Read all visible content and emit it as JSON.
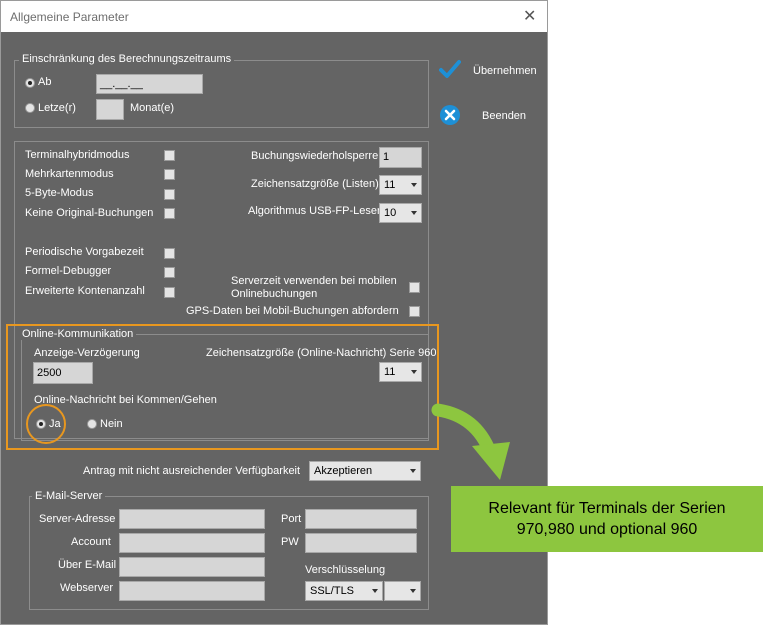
{
  "window": {
    "title": "Allgemeine Parameter",
    "close_symbol": "✕"
  },
  "actions": {
    "apply_label": "Übernehmen",
    "exit_label": "Beenden"
  },
  "period": {
    "legend": "Einschränkung des Berechnungszeitraums",
    "ab_label": "Ab",
    "ab_value": "__.__.__",
    "last_label": "Letze(r)",
    "last_value": "",
    "month_label": "Monat(e)"
  },
  "settings": {
    "checkboxes": {
      "terminalhybrid": "Terminalhybridmodus",
      "mehrkarten": "Mehrkartenmodus",
      "byte5": "5-Byte-Modus",
      "keine_original": "Keine Original-Buchungen",
      "periodische": "Periodische Vorgabezeit",
      "formel": "Formel-Debugger",
      "erweiterte": "Erweiterte Kontenanzahl",
      "serverzeit_line1": "Serverzeit verwenden bei mobilen",
      "serverzeit_line2": "Onlinebuchungen",
      "gps": "GPS-Daten bei Mobil-Buchungen abfordern"
    },
    "sperre_label": "Buchungswiederholsperre",
    "sperre_value": "1",
    "font_list_label": "Zeichensatzgröße (Listen)",
    "font_list_value": "11",
    "algo_label": "Algorithmus USB-FP-Leser",
    "algo_value": "10"
  },
  "online": {
    "legend": "Online-Kommunikation",
    "delay_label": "Anzeige-Verzögerung",
    "delay_value": "2500",
    "font_label": "Zeichensatzgröße (Online-Nachricht) Serie 960",
    "font_value": "11",
    "message_label": "Online-Nachricht bei Kommen/Gehen",
    "ja_label": "Ja",
    "nein_label": "Nein"
  },
  "antrag": {
    "label": "Antrag mit nicht ausreichender Verfügbarkeit",
    "value": "Akzeptieren"
  },
  "email": {
    "legend": "E-Mail-Server",
    "server_label": "Server-Adresse",
    "account_label": "Account",
    "via_label": "Über E-Mail",
    "webserver_label": "Webserver",
    "port_label": "Port",
    "pw_label": "PW",
    "encryption_label": "Verschlüsselung",
    "encryption_value": "SSL/TLS",
    "encryption_extra": ""
  },
  "callout": {
    "line1": "Relevant für Terminals der Serien",
    "line2": "970,980 und optional 960"
  },
  "colors": {
    "dialog_bg": "#646464",
    "highlight": "#e8971f",
    "callout": "#8dc63f",
    "accent": "#1e90d6"
  }
}
